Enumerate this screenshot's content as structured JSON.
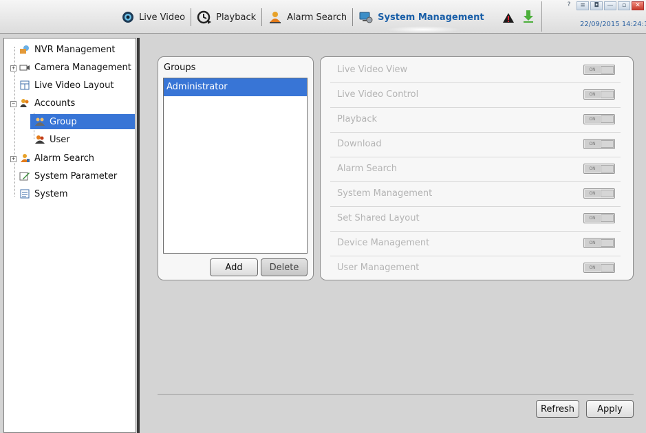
{
  "nav": {
    "items": [
      {
        "label": "Live Video",
        "icon": "live-video-icon"
      },
      {
        "label": "Playback",
        "icon": "playback-icon"
      },
      {
        "label": "Alarm Search",
        "icon": "alarm-search-icon"
      },
      {
        "label": "System Management",
        "icon": "system-management-icon",
        "active": true
      }
    ]
  },
  "header": {
    "datetime": "22/09/2015 14:24:1",
    "win_controls": [
      "?",
      "≡",
      "◘",
      "—",
      "▫",
      "✕"
    ]
  },
  "sidebar": {
    "items": [
      {
        "label": "NVR Management"
      },
      {
        "label": "Camera Management"
      },
      {
        "label": "Live Video Layout"
      },
      {
        "label": "Accounts"
      },
      {
        "label": "Group"
      },
      {
        "label": "User"
      },
      {
        "label": "Alarm Search"
      },
      {
        "label": "System Parameter"
      },
      {
        "label": "System"
      }
    ]
  },
  "groups": {
    "title": "Groups",
    "list": [
      "Administrator"
    ],
    "add_label": "Add",
    "delete_label": "Delete"
  },
  "permissions": {
    "toggle_label": "ON",
    "items": [
      "Live Video View",
      "Live Video Control",
      "Playback",
      "Download",
      "Alarm Search",
      "System Management",
      "Set Shared Layout",
      "Device Management",
      "User Management"
    ]
  },
  "footer": {
    "refresh_label": "Refresh",
    "apply_label": "Apply"
  },
  "colors": {
    "accent": "#3875d6",
    "active_nav": "#1a5fa8",
    "disabled_text": "#b4b4b4"
  }
}
